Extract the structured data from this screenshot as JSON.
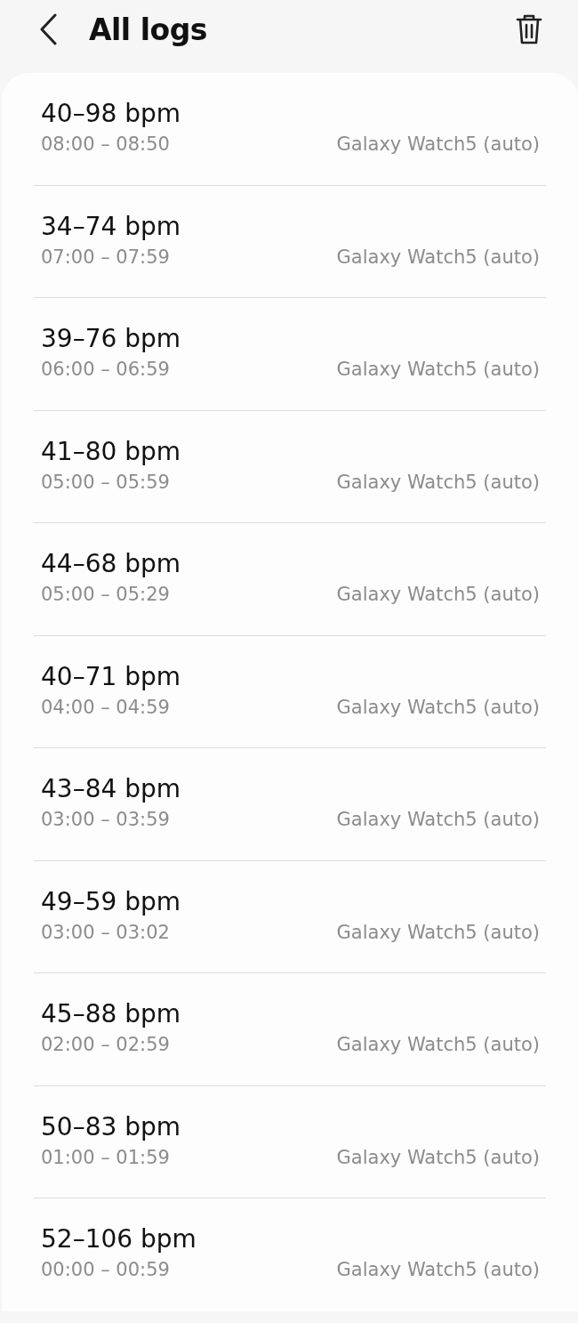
{
  "header": {
    "title": "All logs"
  },
  "logs": [
    {
      "range": "40–98 bpm",
      "time": "08:00 – 08:50",
      "source": "Galaxy Watch5 (auto)"
    },
    {
      "range": "34–74 bpm",
      "time": "07:00 – 07:59",
      "source": "Galaxy Watch5 (auto)"
    },
    {
      "range": "39–76 bpm",
      "time": "06:00 – 06:59",
      "source": "Galaxy Watch5 (auto)"
    },
    {
      "range": "41–80 bpm",
      "time": "05:00 – 05:59",
      "source": "Galaxy Watch5 (auto)"
    },
    {
      "range": "44–68 bpm",
      "time": "05:00 – 05:29",
      "source": "Galaxy Watch5 (auto)"
    },
    {
      "range": "40–71 bpm",
      "time": "04:00 – 04:59",
      "source": "Galaxy Watch5 (auto)"
    },
    {
      "range": "43–84 bpm",
      "time": "03:00 – 03:59",
      "source": "Galaxy Watch5 (auto)"
    },
    {
      "range": "49–59 bpm",
      "time": "03:00 – 03:02",
      "source": "Galaxy Watch5 (auto)"
    },
    {
      "range": "45–88 bpm",
      "time": "02:00 – 02:59",
      "source": "Galaxy Watch5 (auto)"
    },
    {
      "range": "50–83 bpm",
      "time": "01:00 – 01:59",
      "source": "Galaxy Watch5 (auto)"
    },
    {
      "range": "52–106 bpm",
      "time": "00:00 – 00:59",
      "source": "Galaxy Watch5 (auto)"
    }
  ]
}
